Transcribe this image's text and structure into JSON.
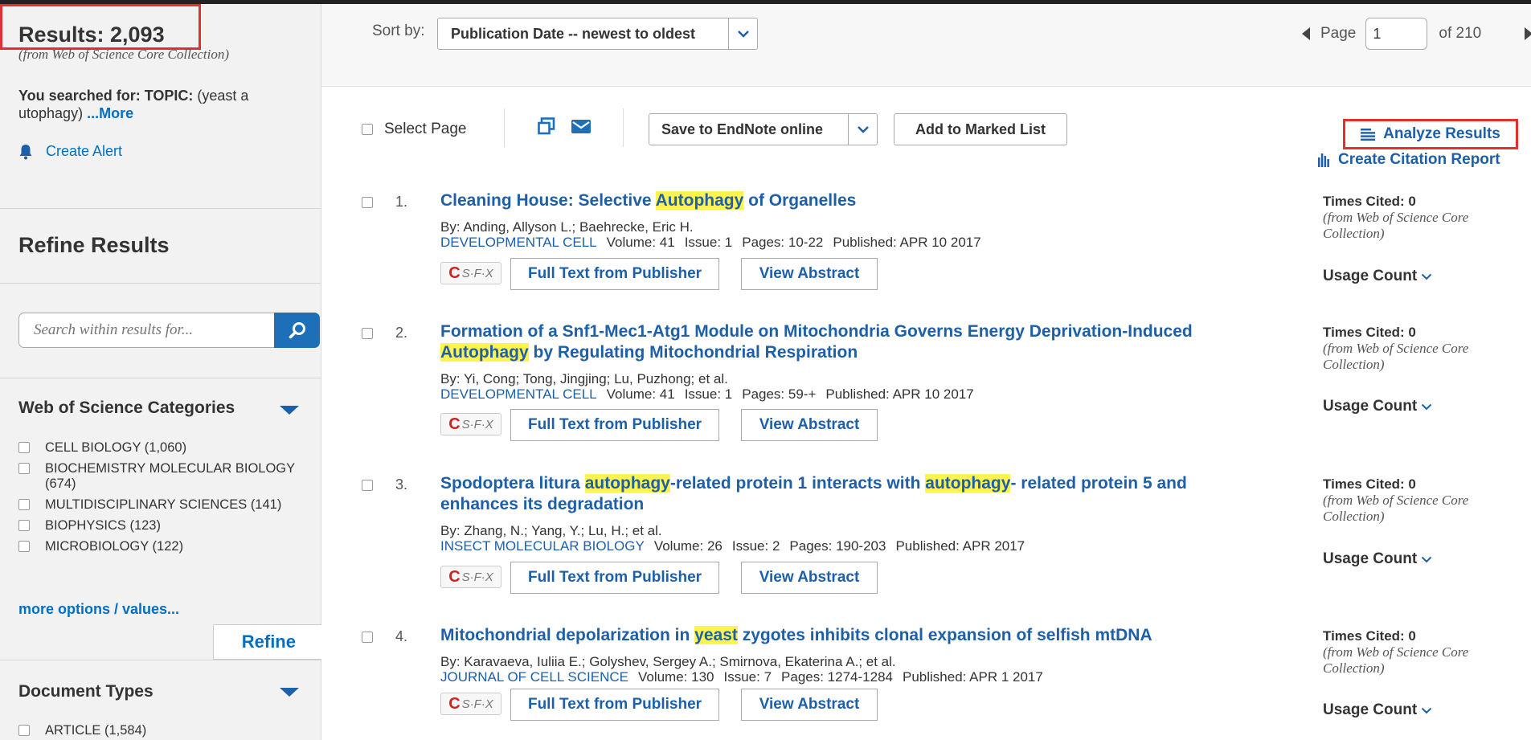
{
  "summary": {
    "results_label": "Results: 2,093",
    "results_source": "(from Web of Science Core Collection)",
    "searched_prefix": "You searched for:",
    "searched_field": "TOPIC:",
    "searched_query": "(yeast a utophagy)",
    "more_link": "...More",
    "create_alert": "Create Alert"
  },
  "refine": {
    "title": "Refine Results",
    "search_placeholder": "Search within results for...",
    "categories_title": "Web of Science Categories",
    "categories": [
      {
        "label": "CELL BIOLOGY (1,060)"
      },
      {
        "label": "BIOCHEMISTRY MOLECULAR BIOLOGY (674)"
      },
      {
        "label": "MULTIDISCIPLINARY SCIENCES (141)"
      },
      {
        "label": "BIOPHYSICS (123)"
      },
      {
        "label": "MICROBIOLOGY (122)"
      }
    ],
    "more_options": "more options / values...",
    "refine_button": "Refine",
    "doc_types_title": "Document Types",
    "doc_types": [
      {
        "label": "ARTICLE (1,584)"
      }
    ]
  },
  "topbar": {
    "sort_label": "Sort by:",
    "sort_value": "Publication Date -- newest to oldest",
    "page_label": "Page",
    "page_value": "1",
    "page_total": "of  210"
  },
  "toolbar": {
    "select_page": "Select Page",
    "save_endnote": "Save to EndNote online",
    "add_marked": "Add to Marked List",
    "analyze": "Analyze Results",
    "citation_report": "Create Citation Report"
  },
  "record_labels": {
    "full_text": "Full Text from Publisher",
    "view_abstract": "View Abstract",
    "sfx": "S·F·X",
    "times_cited": "Times Cited: 0",
    "times_cited_src": "(from Web of Science Core Collection)",
    "usage_count": "Usage Count"
  },
  "records": [
    {
      "num": "1.",
      "title_parts": [
        "Cleaning House: Selective ",
        "Autophagy",
        " of Organelles"
      ],
      "authors": "By: Anding, Allyson L.; Baehrecke, Eric H.",
      "journal": "DEVELOPMENTAL CELL",
      "volume": "Volume: 41",
      "issue": "Issue: 1",
      "pages": "Pages: 10-22",
      "published": "Published: APR 10 2017"
    },
    {
      "num": "2.",
      "title_parts": [
        "Formation of a Snf1-Mec1-Atg1 Module on Mitochondria Governs Energy Deprivation-Induced ",
        "Autophagy",
        " by Regulating Mitochondrial Respiration"
      ],
      "authors": "By: Yi, Cong; Tong, Jingjing; Lu, Puzhong; et al.",
      "journal": "DEVELOPMENTAL CELL",
      "volume": "Volume: 41",
      "issue": "Issue: 1",
      "pages": "Pages: 59-+",
      "published": "Published: APR 10 2017"
    },
    {
      "num": "3.",
      "title_parts": [
        "Spodoptera litura ",
        "autophagy",
        "-related protein 1 interacts with ",
        "autophagy",
        "- related protein 5 and enhances its degradation"
      ],
      "authors": "By: Zhang, N.; Yang, Y.; Lu, H.; et al.",
      "journal": "INSECT MOLECULAR BIOLOGY",
      "volume": "Volume: 26",
      "issue": "Issue: 2",
      "pages": "Pages: 190-203",
      "published": "Published: APR 2017"
    },
    {
      "num": "4.",
      "title_parts": [
        "Mitochondrial depolarization in ",
        "yeast",
        " zygotes inhibits clonal expansion of selfish mtDNA"
      ],
      "authors": "By: Karavaeva, Iuliia E.; Golyshev, Sergey A.; Smirnova, Ekaterina A.; et al.",
      "journal": "JOURNAL OF CELL SCIENCE",
      "volume": "Volume: 130",
      "issue": "Issue: 7",
      "pages": "Pages: 1274-1284",
      "published": "Published: APR 1 2017"
    }
  ],
  "colors": {
    "link": "#1d5fa8",
    "highlight": "#fff44f",
    "annotation_box": "#e03030",
    "search_button": "#1d6fb8"
  },
  "icons": [
    "bell-icon",
    "search-icon",
    "chevron-down-icon",
    "print-icon",
    "email-icon",
    "analyze-lines-icon",
    "bar-chart-icon",
    "triangle-down-icon",
    "prev-page-icon",
    "next-page-icon"
  ]
}
